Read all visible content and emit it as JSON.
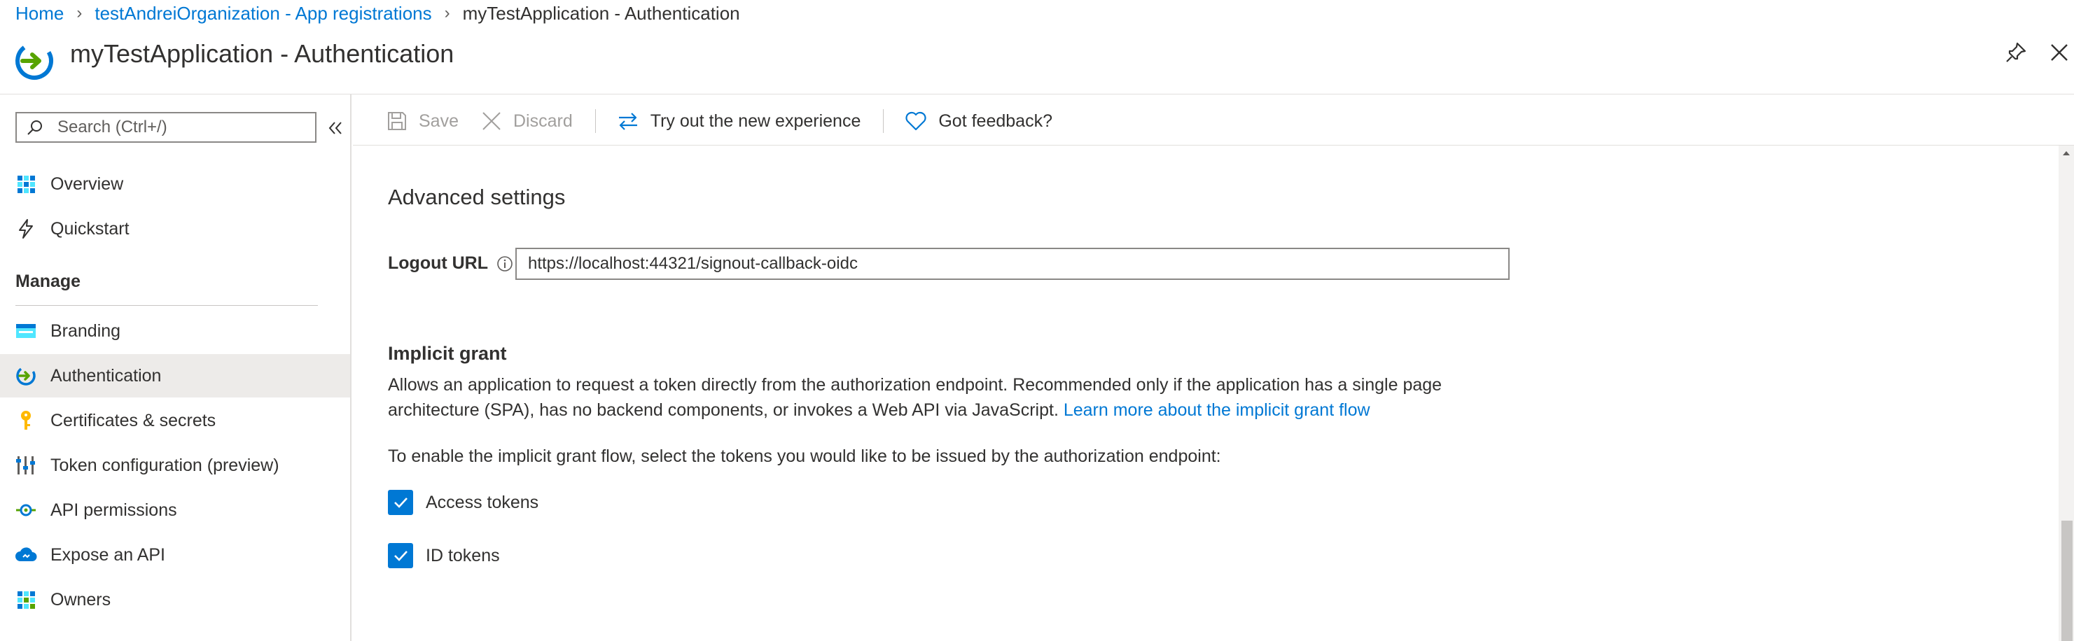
{
  "breadcrumb": {
    "items": [
      "Home",
      "testAndreiOrganization - App registrations"
    ],
    "current": "myTestApplication - Authentication"
  },
  "header": {
    "title": "myTestApplication - Authentication"
  },
  "sidebar": {
    "search_placeholder": "Search (Ctrl+/)",
    "items": [
      {
        "label": "Overview",
        "icon": "overview-grid-icon"
      },
      {
        "label": "Quickstart",
        "icon": "lightning-icon"
      }
    ],
    "manage_label": "Manage",
    "manage_items": [
      {
        "label": "Branding",
        "icon": "branding-icon"
      },
      {
        "label": "Authentication",
        "icon": "authentication-icon",
        "active": true
      },
      {
        "label": "Certificates & secrets",
        "icon": "key-icon"
      },
      {
        "label": "Token configuration (preview)",
        "icon": "token-config-icon"
      },
      {
        "label": "API permissions",
        "icon": "api-permissions-icon"
      },
      {
        "label": "Expose an API",
        "icon": "cloud-icon"
      },
      {
        "label": "Owners",
        "icon": "owners-grid-icon"
      }
    ]
  },
  "toolbar": {
    "save_label": "Save",
    "discard_label": "Discard",
    "try_label": "Try out the new experience",
    "feedback_label": "Got feedback?"
  },
  "main": {
    "section_title": "Advanced settings",
    "logout_label": "Logout URL",
    "logout_value": "https://localhost:44321/signout-callback-oidc",
    "implicit_title": "Implicit grant",
    "implicit_desc": "Allows an application to request a token directly from the authorization endpoint. Recommended only if the application has a single page architecture (SPA), has no backend components, or invokes a Web API via JavaScript.",
    "implicit_link": "Learn more about the implicit grant flow",
    "enable_text": "To enable the implicit grant flow, select the tokens you would like to be issued by the authorization endpoint:",
    "checkboxes": [
      {
        "label": "Access tokens",
        "checked": true
      },
      {
        "label": "ID tokens",
        "checked": true
      }
    ]
  },
  "colors": {
    "accent": "#0078d4",
    "active_bg": "#edebe9",
    "text": "#323130"
  }
}
